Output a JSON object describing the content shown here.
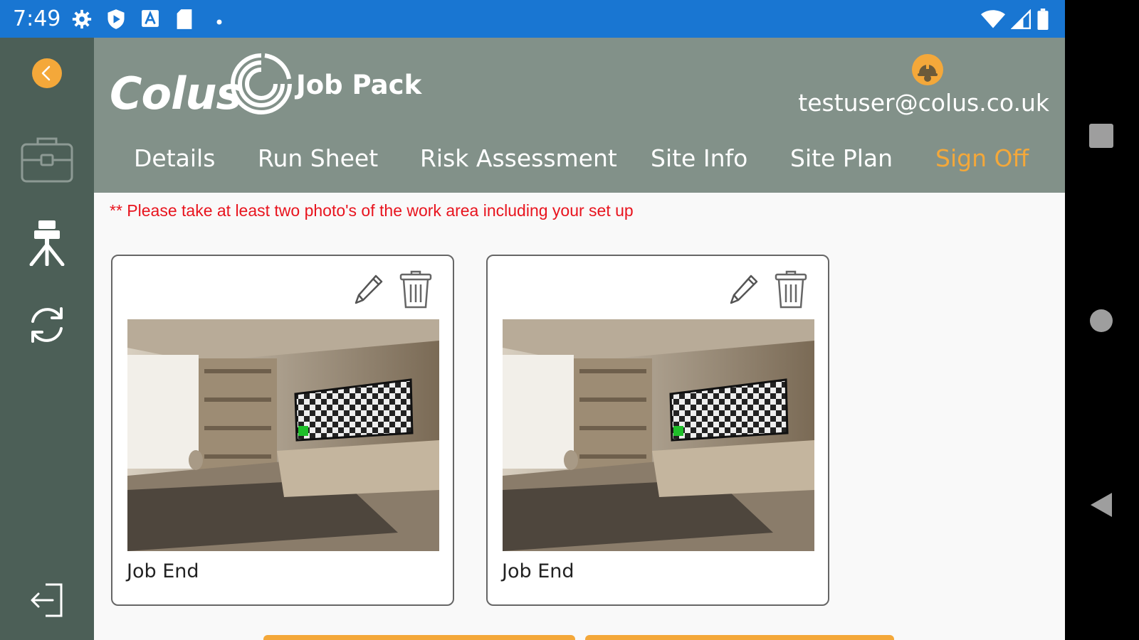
{
  "status_bar": {
    "time": "7:49",
    "left_icons": [
      "settings-icon",
      "shield-icon",
      "font-icon",
      "sd-card-icon",
      "dot-icon"
    ],
    "right_icons": [
      "wifi-icon",
      "signal-icon",
      "battery-icon"
    ]
  },
  "sidebar": {
    "items": [
      {
        "icon": "back-arrow-icon"
      },
      {
        "icon": "briefcase-icon"
      },
      {
        "icon": "survey-tripod-icon"
      },
      {
        "icon": "sync-icon"
      },
      {
        "icon": "logout-icon"
      }
    ]
  },
  "header": {
    "logo_text": "Colus",
    "title": "Job Pack",
    "user_email": "testuser@colus.co.uk",
    "user_icon": "hard-hat-icon"
  },
  "tabs": [
    {
      "label": "Details"
    },
    {
      "label": "Run Sheet"
    },
    {
      "label": "Risk Assessment"
    },
    {
      "label": "Site Info"
    },
    {
      "label": "Site Plan"
    },
    {
      "label": "Sign Off",
      "active": true
    }
  ],
  "notice": "** Please take at least two photo's of the work area including your set up",
  "photos": [
    {
      "label": "Job End"
    },
    {
      "label": "Job End"
    }
  ],
  "colors": {
    "accent": "#f4a83a",
    "sidebar": "#4c5f57",
    "header": "#829189",
    "status_bar": "#1976d2",
    "notice": "#e8141e"
  }
}
